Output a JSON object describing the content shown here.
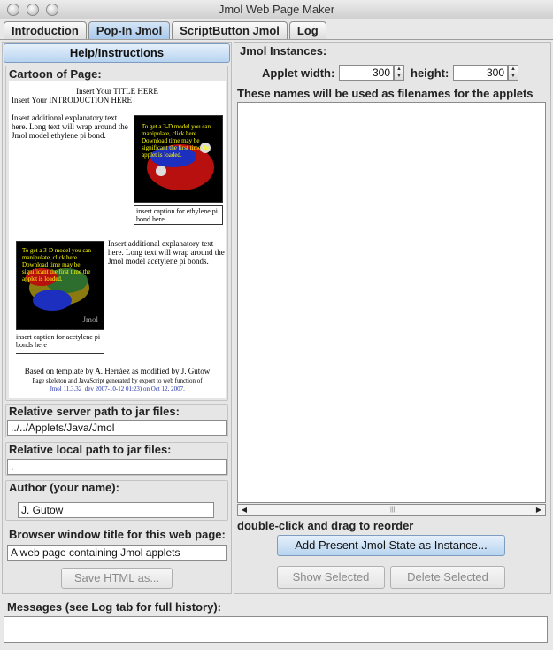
{
  "window": {
    "title": "Jmol Web Page Maker"
  },
  "tabs": [
    {
      "label": "Introduction"
    },
    {
      "label": "Pop-In Jmol"
    },
    {
      "label": "ScriptButton Jmol"
    },
    {
      "label": "Log"
    }
  ],
  "left": {
    "help_button": "Help/Instructions",
    "cartoon_label": "Cartoon of Page:",
    "cartoon": {
      "title_line": "Insert Your TITLE HERE",
      "intro_line": "Insert Your INTRODUCTION HERE",
      "text1": "Insert additional explanatory text here. Long text will wrap around the Jmol model ethylene pi bond.",
      "mol1_overlay": "To get a 3-D model you can manipulate, click here. Download time may be significant the first time the applet is loaded.",
      "caption1": "insert caption for ethylene pi bond here",
      "text2": "Insert additional explanatory text here. Long text will wrap around the Jmol model acetylene pi bonds.",
      "mol2_overlay": "To get a 3-D model you can manipulate, click here. Download time may be significant the first time the applet is loaded.",
      "mol2_watermark": "Jmol",
      "caption2": "insert caption for acetylene pi bonds here",
      "footer1": "Based on template by A. Herráez as modified by J. Gutow",
      "footer2": "Page skeleton and JavaScript generated by export to web function of",
      "footer3": "Jmol 11.3.32_dev 2007-10-12 01:23) on Oct 12, 2007."
    },
    "server_path_label": "Relative server path to jar files:",
    "server_path_value": "../../Applets/Java/Jmol",
    "local_path_label": "Relative local path to jar files:",
    "local_path_value": ".",
    "author_label": "Author (your name):",
    "author_value": "J. Gutow",
    "browser_title_label": "Browser window title for this web page:",
    "browser_title_value": "A web page containing Jmol applets",
    "save_button": "Save HTML as..."
  },
  "right": {
    "instances_label": "Jmol Instances:",
    "applet_width_label": "Applet width:",
    "applet_width_value": "300",
    "height_label": "height:",
    "height_value": "300",
    "names_note": "These names will be used as filenames for the applets",
    "reorder_note": "double-click and drag to reorder",
    "add_button": "Add Present Jmol State as Instance...",
    "show_button": "Show Selected",
    "delete_button": "Delete Selected"
  },
  "messages": {
    "label": "Messages (see Log tab for full history):"
  }
}
